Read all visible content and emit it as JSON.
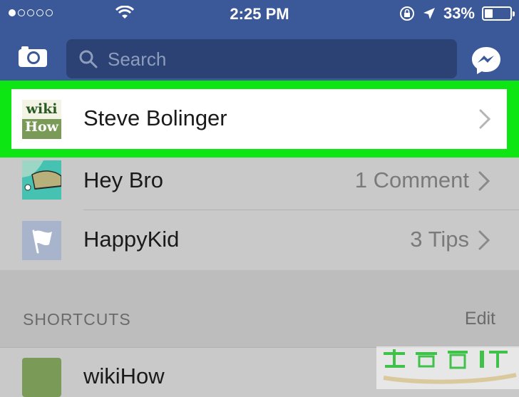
{
  "status_bar": {
    "carrier_dots": 5,
    "time": "2:25 PM",
    "battery_percent": "33%",
    "battery_level": 0.33
  },
  "nav": {
    "search_placeholder": "Search"
  },
  "favorites": [
    {
      "name": "Steve Bolinger",
      "meta": ""
    },
    {
      "name": "Hey Bro",
      "meta": "1 Comment"
    },
    {
      "name": "HappyKid",
      "meta": "3 Tips"
    }
  ],
  "shortcuts": {
    "header": "SHORTCUTS",
    "edit_label": "Edit",
    "items": [
      {
        "name": "wikiHow"
      }
    ]
  },
  "avatar_steve": {
    "line1": "wiki",
    "line2": "How"
  },
  "colors": {
    "facebook_blue": "#3b5998",
    "highlight_green": "#0de612",
    "list_bg": "#c9c9c9"
  }
}
